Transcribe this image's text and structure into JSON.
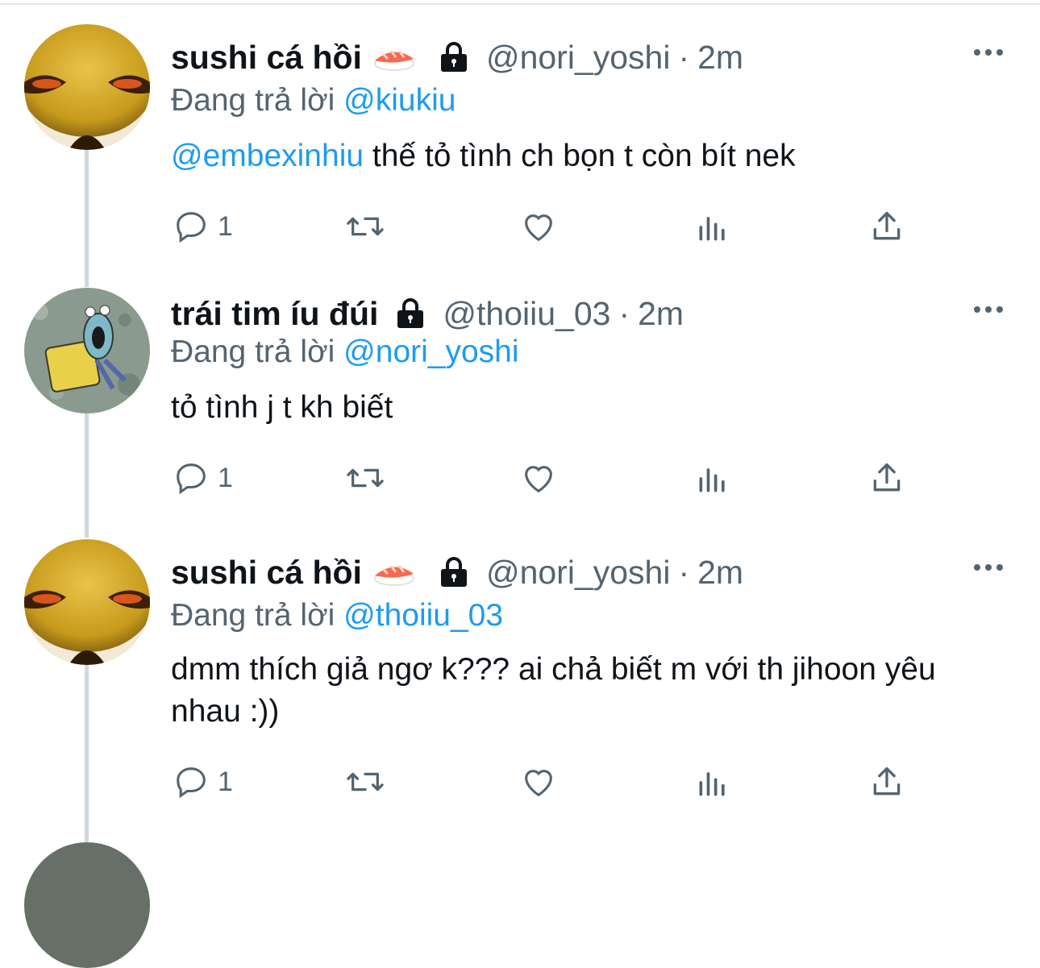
{
  "tweets": [
    {
      "name": "sushi cá hồi",
      "emoji": "sushi-emoji",
      "handle": "@nori_yoshi",
      "time": "2m",
      "replying_prefix": "Đang trả lời",
      "replying_to": "@kiukiu",
      "body_mention": "@embexinhiu",
      "body": " thế tỏ tình ch bọn t còn bít nek",
      "reply_count": "1"
    },
    {
      "name": "trái tim íu đúi",
      "emoji": "",
      "handle": "@thoiiu_03",
      "time": "2m",
      "replying_prefix": "Đang trả lời",
      "replying_to": "@nori_yoshi",
      "body_mention": "",
      "body": "tỏ tình j t kh biết",
      "reply_count": "1"
    },
    {
      "name": "sushi cá hồi",
      "emoji": "sushi-emoji",
      "handle": "@nori_yoshi",
      "time": "2m",
      "replying_prefix": "Đang trả lời",
      "replying_to": "@thoiiu_03",
      "body_mention": "",
      "body": "dmm thích giả ngơ k??? ai chả biết m với th jihoon yêu nhau :))",
      "reply_count": "1"
    }
  ],
  "separator": "·",
  "colors": {
    "mention": "#1d9bf0",
    "secondary": "#536471",
    "primary": "#0f1419"
  }
}
